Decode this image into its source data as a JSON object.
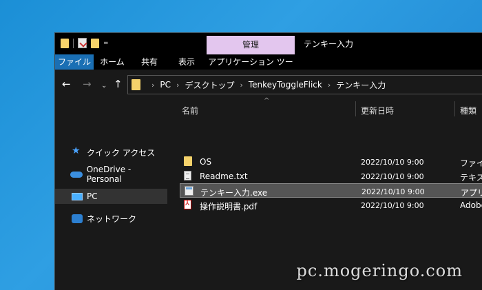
{
  "title_bar": {
    "context_tab_label": "管理",
    "window_title": "テンキー入力",
    "qat_dropdown": "="
  },
  "ribbon": {
    "file": "ファイル",
    "home": "ホーム",
    "share": "共有",
    "view": "表示",
    "app_tools": "アプリケーション ツール"
  },
  "nav": {
    "back": "←",
    "forward": "→",
    "recent": "⌄",
    "up": "↑"
  },
  "address": {
    "crumbs": [
      "PC",
      "デスクトップ",
      "TenkeyToggleFlick",
      "テンキー入力"
    ],
    "separator": "›"
  },
  "sidebar": {
    "items": [
      {
        "label": "クイック アクセス",
        "icon": "star-icon"
      },
      {
        "label": "OneDrive - Personal",
        "icon": "cloud-icon"
      },
      {
        "label": "PC",
        "icon": "computer-icon"
      },
      {
        "label": "ネットワーク",
        "icon": "network-icon"
      }
    ]
  },
  "columns": {
    "name": "名前",
    "date": "更新日時",
    "type": "種類",
    "sort_indicator": "^"
  },
  "files": [
    {
      "name": "OS",
      "date": "2022/10/10 9:00",
      "type": "ファイル",
      "icon": "folder-icon"
    },
    {
      "name": "Readme.txt",
      "date": "2022/10/10 9:00",
      "type": "テキスト",
      "icon": "text-file-icon"
    },
    {
      "name": "テンキー入力.exe",
      "date": "2022/10/10 9:00",
      "type": "アプリケ",
      "icon": "exe-icon",
      "selected": true
    },
    {
      "name": "操作説明書.pdf",
      "date": "2022/10/10 9:00",
      "type": "Adobe",
      "icon": "pdf-icon"
    }
  ],
  "watermark": "pc.mogeringo.com",
  "colors": {
    "desktop": "#1b8fd6",
    "context_tab": "#e3c6ee",
    "file_tab": "#1a6fb4",
    "window_bg": "#191919",
    "folder": "#f5d26b"
  }
}
